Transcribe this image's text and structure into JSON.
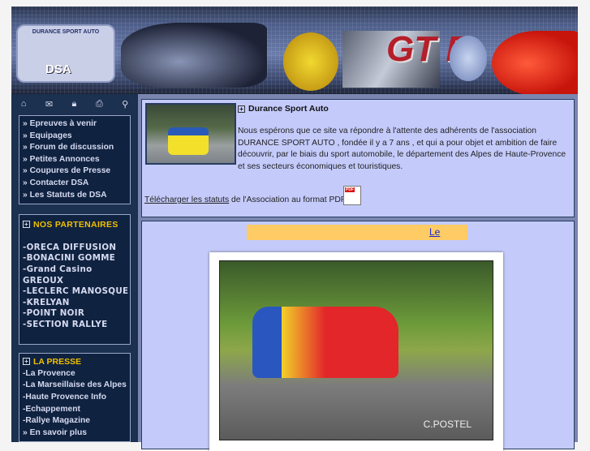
{
  "banner": {
    "logo_text": "DURANCE SPORT AUTO",
    "logo_abbr": "DSA",
    "badge": "GT R"
  },
  "toolbar": {
    "icons": [
      "home-icon",
      "mail-icon",
      "lock-icon",
      "print-icon",
      "search-icon"
    ]
  },
  "menu": {
    "items": [
      "» Epreuves à venir",
      "» Equipages",
      "» Forum de discussion",
      "» Petites Annonces",
      "» Coupures de Presse",
      "» Contacter DSA",
      "»  Les Statuts de DSA"
    ]
  },
  "partners": {
    "title": "NOS PARTENAIRES",
    "items": [
      "-ORECA DIFFUSION",
      "-BONACINI GOMME",
      "-Grand Casino",
      "GREOUX",
      "-LECLERC MANOSQUE",
      "-KRELYAN",
      "-POINT NOIR",
      "-SECTION RALLYE"
    ]
  },
  "press": {
    "title": "LA PRESSE",
    "items": [
      "-La Provence",
      "-La Marseillaise des Alpes",
      "-Haute Provence Info",
      "-Echappement",
      "-Rallye Magazine",
      "» En savoir plus"
    ]
  },
  "intro": {
    "title": "Durance Sport Auto",
    "body": "Nous espérons que ce site va répondre à l'attente des adhérents de l'association DURANCE SPORT AUTO , fondée il y a 7 ans , et qui a pour objet et ambition de faire découvrir, par le biais du sport automobile, le département des Alpes de Haute-Provence et ses secteurs économiques et touristiques.",
    "download_link": "Télécharger les statuts",
    "download_rest": " de l'Association au format PDF",
    "pdf_label": "PDF"
  },
  "news": {
    "link": "Le",
    "photo_credit": "C.POSTEL"
  }
}
